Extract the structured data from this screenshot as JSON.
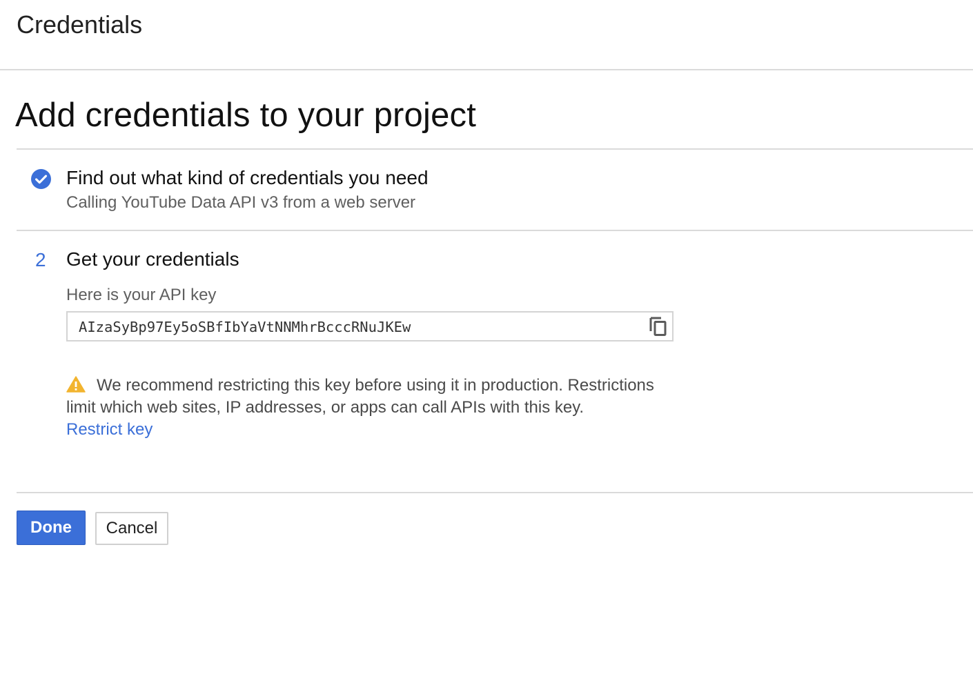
{
  "topbar": {
    "title": "Credentials"
  },
  "main": {
    "heading": "Add credentials to your project"
  },
  "step1": {
    "title": "Find out what kind of credentials you need",
    "subtitle": "Calling YouTube Data API v3 from a web server",
    "status_icon": "check-circle-icon"
  },
  "step2": {
    "number": "2",
    "title": "Get your credentials",
    "key_label": "Here is your API key",
    "api_key": "AIzaSyBp97Ey5oSBfIbYaVtNNMhrBcccRNuJKEw",
    "copy_icon": "copy-icon",
    "warning_icon": "warning-icon",
    "warning_text": "We recommend restricting this key before using it in production. Restrictions limit which web sites, IP addresses, or apps can call APIs with this key.",
    "restrict_link": "Restrict key"
  },
  "actions": {
    "done_label": "Done",
    "cancel_label": "Cancel"
  },
  "colors": {
    "accent": "#3b6fd8",
    "warning": "#f2b42f",
    "divider": "#dadada"
  }
}
